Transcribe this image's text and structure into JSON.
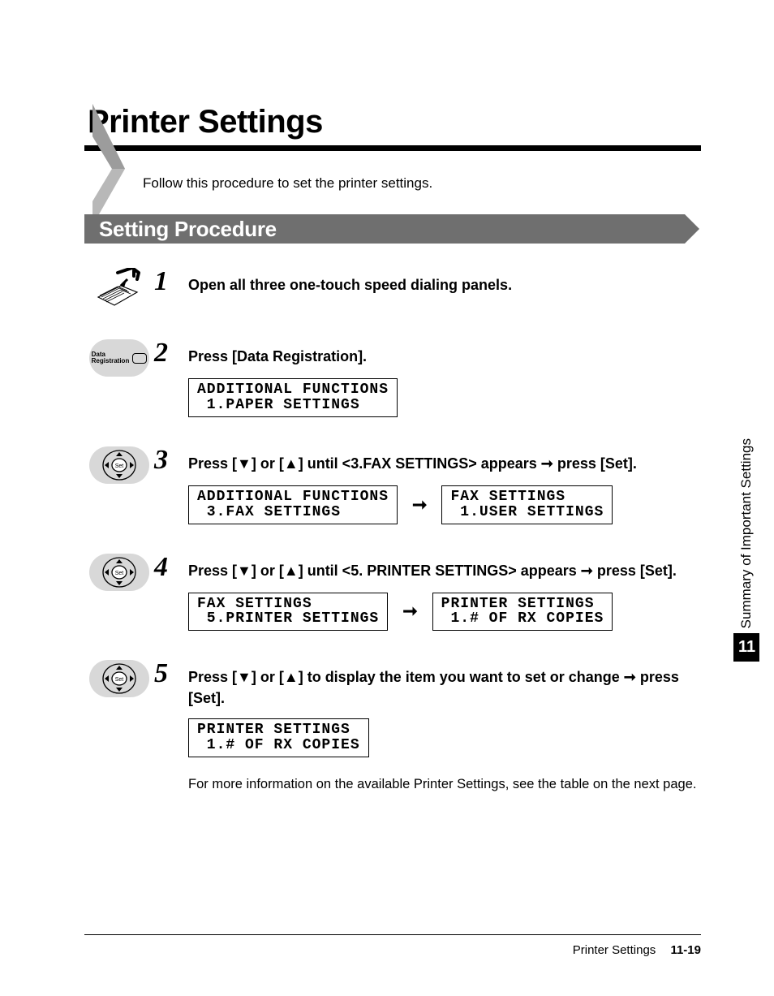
{
  "page_title": "Printer Settings",
  "intro": "Follow this procedure to set the printer settings.",
  "section_heading": "Setting Procedure",
  "steps": {
    "s1": {
      "num": "1",
      "text": "Open all three one-touch speed dialing panels."
    },
    "s2": {
      "num": "2",
      "text": "Press [Data Registration].",
      "icon_label_line1": "Data",
      "icon_label_line2": "Registration",
      "lcd1_line1": "ADDITIONAL FUNCTIONS",
      "lcd1_line2": " 1.PAPER SETTINGS"
    },
    "s3": {
      "num": "3",
      "prefix": "Press [",
      "mid1": "] or [",
      "mid2": "] until <3.FAX SETTINGS> appears ",
      "suffix": " press [Set].",
      "lcd1_line1": "ADDITIONAL FUNCTIONS",
      "lcd1_line2": " 3.FAX SETTINGS",
      "lcd2_line1": "FAX SETTINGS",
      "lcd2_line2": " 1.USER SETTINGS"
    },
    "s4": {
      "num": "4",
      "prefix": "Press [",
      "mid1": "] or [",
      "mid2": "] until <5. PRINTER SETTINGS> appears ",
      "suffix": " press [Set].",
      "lcd1_line1": "FAX SETTINGS",
      "lcd1_line2": " 5.PRINTER SETTINGS",
      "lcd2_line1": "PRINTER SETTINGS",
      "lcd2_line2": " 1.# OF RX COPIES"
    },
    "s5": {
      "num": "5",
      "prefix": "Press [",
      "mid1": "] or [",
      "mid2": "] to display the item you want to set or change ",
      "suffix": " press [Set].",
      "lcd1_line1": "PRINTER SETTINGS",
      "lcd1_line2": " 1.# OF RX COPIES",
      "note": "For more information on the available Printer Settings, see the table on the next page."
    }
  },
  "glyphs": {
    "down": "▼",
    "up": "▲",
    "right_arrow": "➞",
    "flow_arrow": "➞"
  },
  "side": {
    "label": "Summary of Important Settings",
    "chapter": "11"
  },
  "footer": {
    "section": "Printer Settings",
    "page": "11-19"
  }
}
